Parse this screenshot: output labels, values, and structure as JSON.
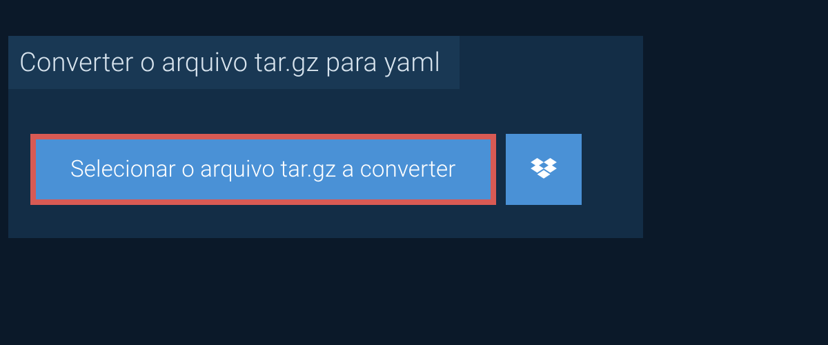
{
  "title": "Converter o arquivo tar.gz para yaml",
  "buttons": {
    "select_file_label": "Selecionar o arquivo tar.gz a converter"
  }
}
